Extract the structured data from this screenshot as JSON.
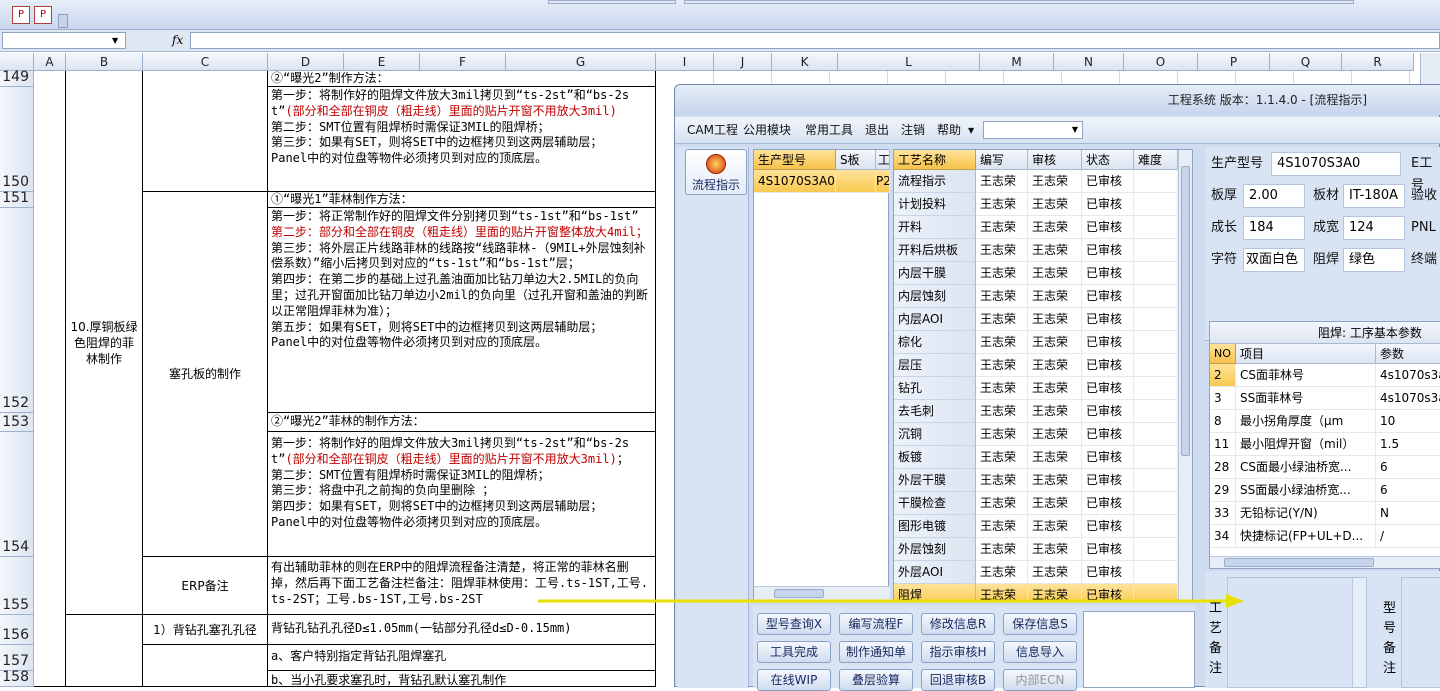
{
  "toolbar": {
    "pdf_icon": "pdf-icon",
    "pdf2_icon": "pdf-settings-icon"
  },
  "formula_bar": {
    "name_box": "",
    "fx_label": "fx",
    "formula": ""
  },
  "columns": [
    "A",
    "B",
    "C",
    "D",
    "E",
    "F",
    "G",
    "I",
    "J",
    "K",
    "L",
    "M",
    "N",
    "O",
    "P",
    "Q",
    "R"
  ],
  "rows": {
    "r149": "149",
    "r150": "150",
    "r151": "151",
    "r152": "152",
    "r153": "153",
    "r154": "154",
    "r155": "155",
    "r156": "156",
    "r157": "157",
    "r158": "158"
  },
  "sheet": {
    "b_section": "10.厚铜板绿色阻焊的菲林制作",
    "c_plug": "塞孔板的制作",
    "c_erp": "ERP备注",
    "c_back": "1）背钻孔塞孔孔径",
    "d149": "②“曝光2”制作方法：",
    "d150_a": "第一步：将制作好的阻焊文件放大3mil拷贝到“ts-2st”和“bs-2st”",
    "d150_red": "(部分和全部在铜皮（粗走线）里面的贴片开窗不用放大3mil)",
    "d150_b": "第二步：SMT位置有阻焊桥时需保证3MIL的阻焊桥；",
    "d150_c": "第三步：如果有SET，则将SET中的边框拷贝到这两层辅助层；",
    "d150_d": "Panel中的对位盘等物件必须拷贝到对应的顶底层。",
    "d151": "①“曝光1”菲林制作方法：",
    "d152_a": "第一步：将正常制作好的阻焊文件分别拷贝到“ts-1st”和“bs-1st”",
    "d152_red": "第二步：部分和全部在铜皮（粗走线）里面的贴片开窗整体放大4mil；",
    "d152_b": "第三步：将外层正片线路菲林的线路按“线路菲林-（9MIL+外层蚀刻补偿系数）”缩小后拷贝到对应的“ts-1st”和“bs-1st”层；",
    "d152_c": "第四步：在第二步的基础上过孔盖油面加比钻刀单边大2.5MIL的负向里；过孔开窗面加比钻刀单边小2mil的负向里（过孔开窗和盖油的判断以正常阻焊菲林为准）；",
    "d152_d": "第五步：如果有SET，则将SET中的边框拷贝到这两层辅助层；",
    "d152_e": "Panel中的对位盘等物件必须拷贝到对应的顶底层。",
    "d153": "②“曝光2”菲林的制作方法：",
    "d154_a": "第一步：将制作好的阻焊文件放大3mil拷贝到“ts-2st”和“bs-2st”",
    "d154_red": "(部分和全部在铜皮（粗走线）里面的贴片开窗不用放大3mil)",
    "d154_b": "；",
    "d154_c": "第二步：SMT位置有阻焊桥时需保证3MIL的阻焊桥；",
    "d154_d": "第三步：将盘中孔之前掏的负向里删除 ；",
    "d154_e": "第四步：如果有SET，则将SET中的边框拷贝到这两层辅助层；",
    "d154_f": "Panel中的对位盘等物件必须拷贝到对应的顶底层。",
    "d155": "有出辅助菲林的则在ERP中的阻焊流程备注清楚，将正常的菲林名删掉，然后再下面工艺备注栏备注：阻焊菲林使用：工号.ts-1ST,工号.ts-2ST；工号.bs-1ST,工号.bs-2ST",
    "d156": "背钻孔钻孔孔径D≤1.05mm(一钻部分孔径d≤D-0.15mm)",
    "d157": "a、客户特别指定背钻孔阻焊塞孔",
    "d158": "b、当小孔要求塞孔时，背钻孔默认塞孔制作"
  },
  "app": {
    "title": "工程系统  版本：1.1.4.0 - [流程指示]",
    "menu": [
      "CAM工程",
      "公用模块",
      "常用工具",
      "退出",
      "注销",
      "帮助"
    ],
    "left_nav": "流程指示",
    "model_grid": {
      "headers": [
        "生产型号",
        "S板",
        "工"
      ],
      "row": [
        "4S1070S3A0",
        "",
        "P2"
      ]
    },
    "process_grid": {
      "headers": [
        "工艺名称",
        "编写",
        "审核",
        "状态",
        "难度"
      ],
      "rows": [
        [
          "流程指示",
          "王志荣",
          "王志荣",
          "已审核"
        ],
        [
          "计划投料",
          "王志荣",
          "王志荣",
          "已审核"
        ],
        [
          "开料",
          "王志荣",
          "王志荣",
          "已审核"
        ],
        [
          "开料后烘板",
          "王志荣",
          "王志荣",
          "已审核"
        ],
        [
          "内层干膜",
          "王志荣",
          "王志荣",
          "已审核"
        ],
        [
          "内层蚀刻",
          "王志荣",
          "王志荣",
          "已审核"
        ],
        [
          "内层AOI",
          "王志荣",
          "王志荣",
          "已审核"
        ],
        [
          "棕化",
          "王志荣",
          "王志荣",
          "已审核"
        ],
        [
          "层压",
          "王志荣",
          "王志荣",
          "已审核"
        ],
        [
          "钻孔",
          "王志荣",
          "王志荣",
          "已审核"
        ],
        [
          "去毛刺",
          "王志荣",
          "王志荣",
          "已审核"
        ],
        [
          "沉铜",
          "王志荣",
          "王志荣",
          "已审核"
        ],
        [
          "板镀",
          "王志荣",
          "王志荣",
          "已审核"
        ],
        [
          "外层干膜",
          "王志荣",
          "王志荣",
          "已审核"
        ],
        [
          "干膜检查",
          "王志荣",
          "王志荣",
          "已审核"
        ],
        [
          "图形电镀",
          "王志荣",
          "王志荣",
          "已审核"
        ],
        [
          "外层蚀刻",
          "王志荣",
          "王志荣",
          "已审核"
        ],
        [
          "外层AOI",
          "王志荣",
          "王志荣",
          "已审核"
        ],
        [
          "阻焊",
          "王志荣",
          "王志荣",
          "已审核"
        ]
      ]
    },
    "info": {
      "prod_label": "生产型号",
      "prod_value": "4S1070S3A0",
      "e_label": "E工号",
      "thick_label": "板厚",
      "thick_value": "2.00",
      "mat_label": "板材",
      "mat_value": "IT-180A",
      "check_label": "验收",
      "len_label": "成长",
      "len_value": "184",
      "wid_label": "成宽",
      "wid_value": "124",
      "pnl_label": "PNL",
      "char_label": "字符",
      "char_value": "双面白色",
      "mask_label": "阻焊",
      "mask_value": "绿色",
      "final_label": "终端"
    },
    "params": {
      "title": "阻焊: 工序基本参数",
      "headers": [
        "NO",
        "项目",
        "参数"
      ],
      "rows": [
        [
          "2",
          "CS面菲林号",
          "4s1070s3a"
        ],
        [
          "3",
          "SS面菲林号",
          "4s1070s3a"
        ],
        [
          "8",
          "最小拐角厚度（μm",
          "10"
        ],
        [
          "11",
          "最小阻焊开窗（mil）",
          "1.5"
        ],
        [
          "28",
          "CS面最小绿油桥宽...",
          "6"
        ],
        [
          "29",
          "SS面最小绿油桥宽...",
          "6"
        ],
        [
          "33",
          "无铅标记(Y/N)",
          "N"
        ],
        [
          "34",
          "快捷标记(FP+UL+D...",
          "/"
        ]
      ]
    },
    "buttons": {
      "b1": "型号查询X",
      "b2": "编写流程F",
      "b3": "修改信息R",
      "b4": "保存信息S",
      "b5": "工具完成",
      "b6": "制作通知单",
      "b7": "指示审核H",
      "b8": "信息导入",
      "b9": "在线WIP",
      "b10": "叠层验算",
      "b11": "回退审核B",
      "b12": "内部ECN"
    },
    "side_labels": {
      "craft": "工艺备注",
      "model": "型号备注"
    }
  }
}
